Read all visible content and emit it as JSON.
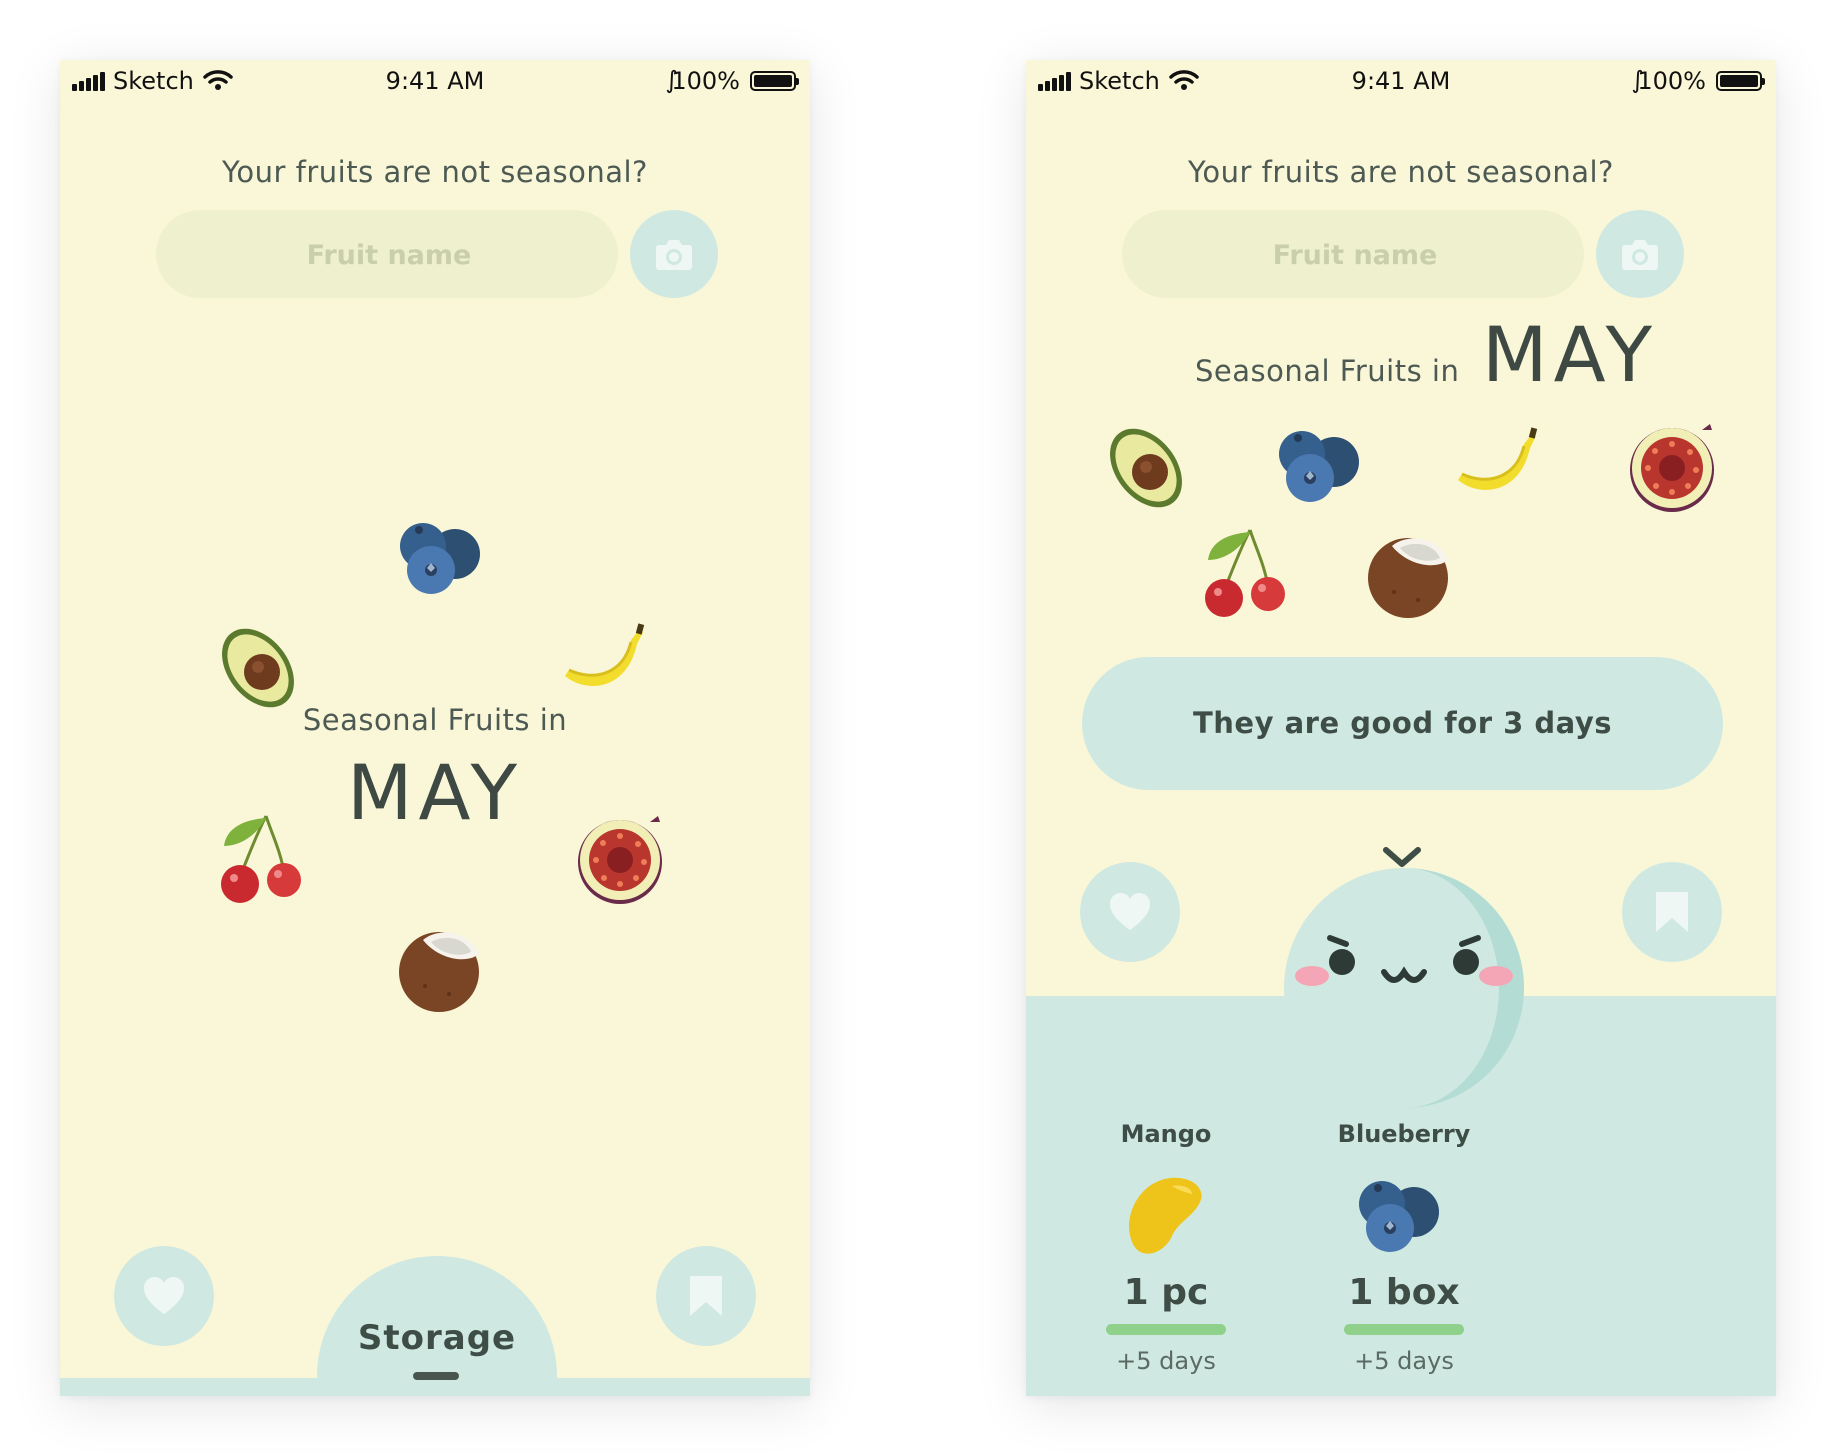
{
  "status_bar": {
    "carrier": "Sketch",
    "time": "9:41 AM",
    "battery": "100%"
  },
  "screen_a": {
    "question": "Your fruits are not seasonal?",
    "search_placeholder": "Fruit name",
    "seasonal_label": "Seasonal Fruits in",
    "month": "MAY",
    "storage_label": "Storage",
    "fruits": [
      "blueberry",
      "avocado",
      "banana",
      "cherry",
      "fig",
      "coconut"
    ]
  },
  "screen_b": {
    "question": "Your fruits are not seasonal?",
    "search_placeholder": "Fruit name",
    "seasonal_label": "Seasonal Fruits in",
    "month": "MAY",
    "fruits": [
      "avocado",
      "blueberry",
      "banana",
      "fig",
      "cherry",
      "coconut"
    ],
    "good_message": "They are good for 3 days",
    "storage_items": [
      {
        "name": "Mango",
        "quantity": "1 pc",
        "extra": "+5 days",
        "icon": "mango-icon"
      },
      {
        "name": "Blueberry",
        "quantity": "1 box",
        "extra": "+5 days",
        "icon": "blueberry-icon"
      }
    ]
  },
  "colors": {
    "background": "#faf7d8",
    "accent_mint": "#cfe9e2",
    "text_dark": "#3f4d47",
    "bar_green": "#8fd08a"
  },
  "icons": [
    "signal-icon",
    "wifi-icon",
    "bluetooth-icon",
    "battery-icon",
    "camera-icon",
    "heart-icon",
    "bookmark-icon",
    "chevron-down-icon"
  ]
}
